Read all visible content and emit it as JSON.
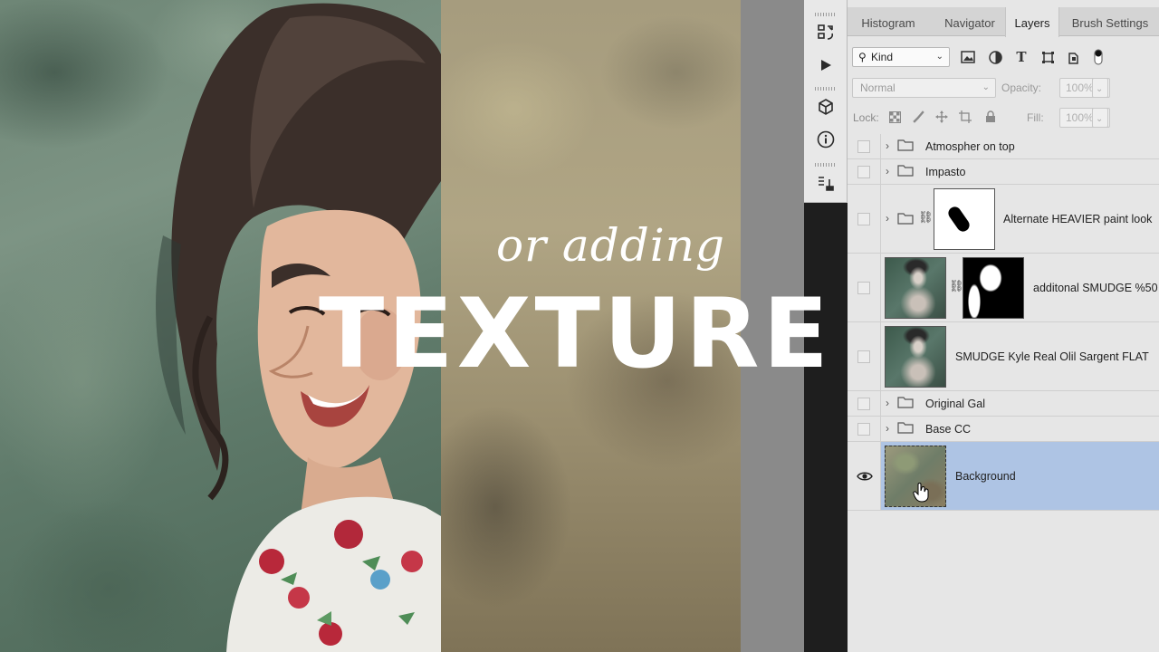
{
  "overlay": {
    "subtitle": "or adding",
    "headline": "TEXTURE"
  },
  "panel": {
    "tabs": [
      {
        "label": "Histogram",
        "active": false
      },
      {
        "label": "Navigator",
        "active": false
      },
      {
        "label": "Layers",
        "active": true
      },
      {
        "label": "Brush Settings",
        "active": false
      }
    ],
    "filter": {
      "kind_label": "Kind",
      "icons": [
        "image-filter-icon",
        "adjustment-filter-icon",
        "type-filter-icon",
        "shape-filter-icon",
        "smart-object-filter-icon",
        "filter-toggle-icon"
      ]
    },
    "blend": {
      "mode": "Normal",
      "opacity_label": "Opacity:",
      "opacity_value": "100%"
    },
    "lock": {
      "label": "Lock:",
      "icons": [
        "lock-transparent-icon",
        "lock-paint-icon",
        "lock-move-icon",
        "lock-artboard-icon",
        "lock-all-icon"
      ],
      "fill_label": "Fill:",
      "fill_value": "100%"
    },
    "layers": [
      {
        "name": "Atmospher on top",
        "type": "group",
        "visible": false,
        "selected": false
      },
      {
        "name": "Impasto",
        "type": "group",
        "visible": false,
        "selected": false
      },
      {
        "name": "Alternate HEAVIER paint look",
        "type": "group-with-mask",
        "visible": false,
        "selected": false
      },
      {
        "name": "additonal SMUDGE %50",
        "type": "layer-with-mask",
        "visible": false,
        "selected": false
      },
      {
        "name": "SMUDGE Kyle Real Olil Sargent FLAT",
        "type": "layer",
        "visible": false,
        "selected": false
      },
      {
        "name": "Original Gal",
        "type": "group",
        "visible": false,
        "selected": false
      },
      {
        "name": "Base CC",
        "type": "group",
        "visible": false,
        "selected": false
      },
      {
        "name": "Background",
        "type": "layer",
        "visible": true,
        "selected": true
      }
    ]
  },
  "tools": [
    "history-icon",
    "play-action-icon",
    "3d-icon",
    "info-icon",
    "properties-icon"
  ],
  "colors": {
    "selected_layer": "#aec4e4",
    "panel_bg": "#e6e6e6"
  }
}
